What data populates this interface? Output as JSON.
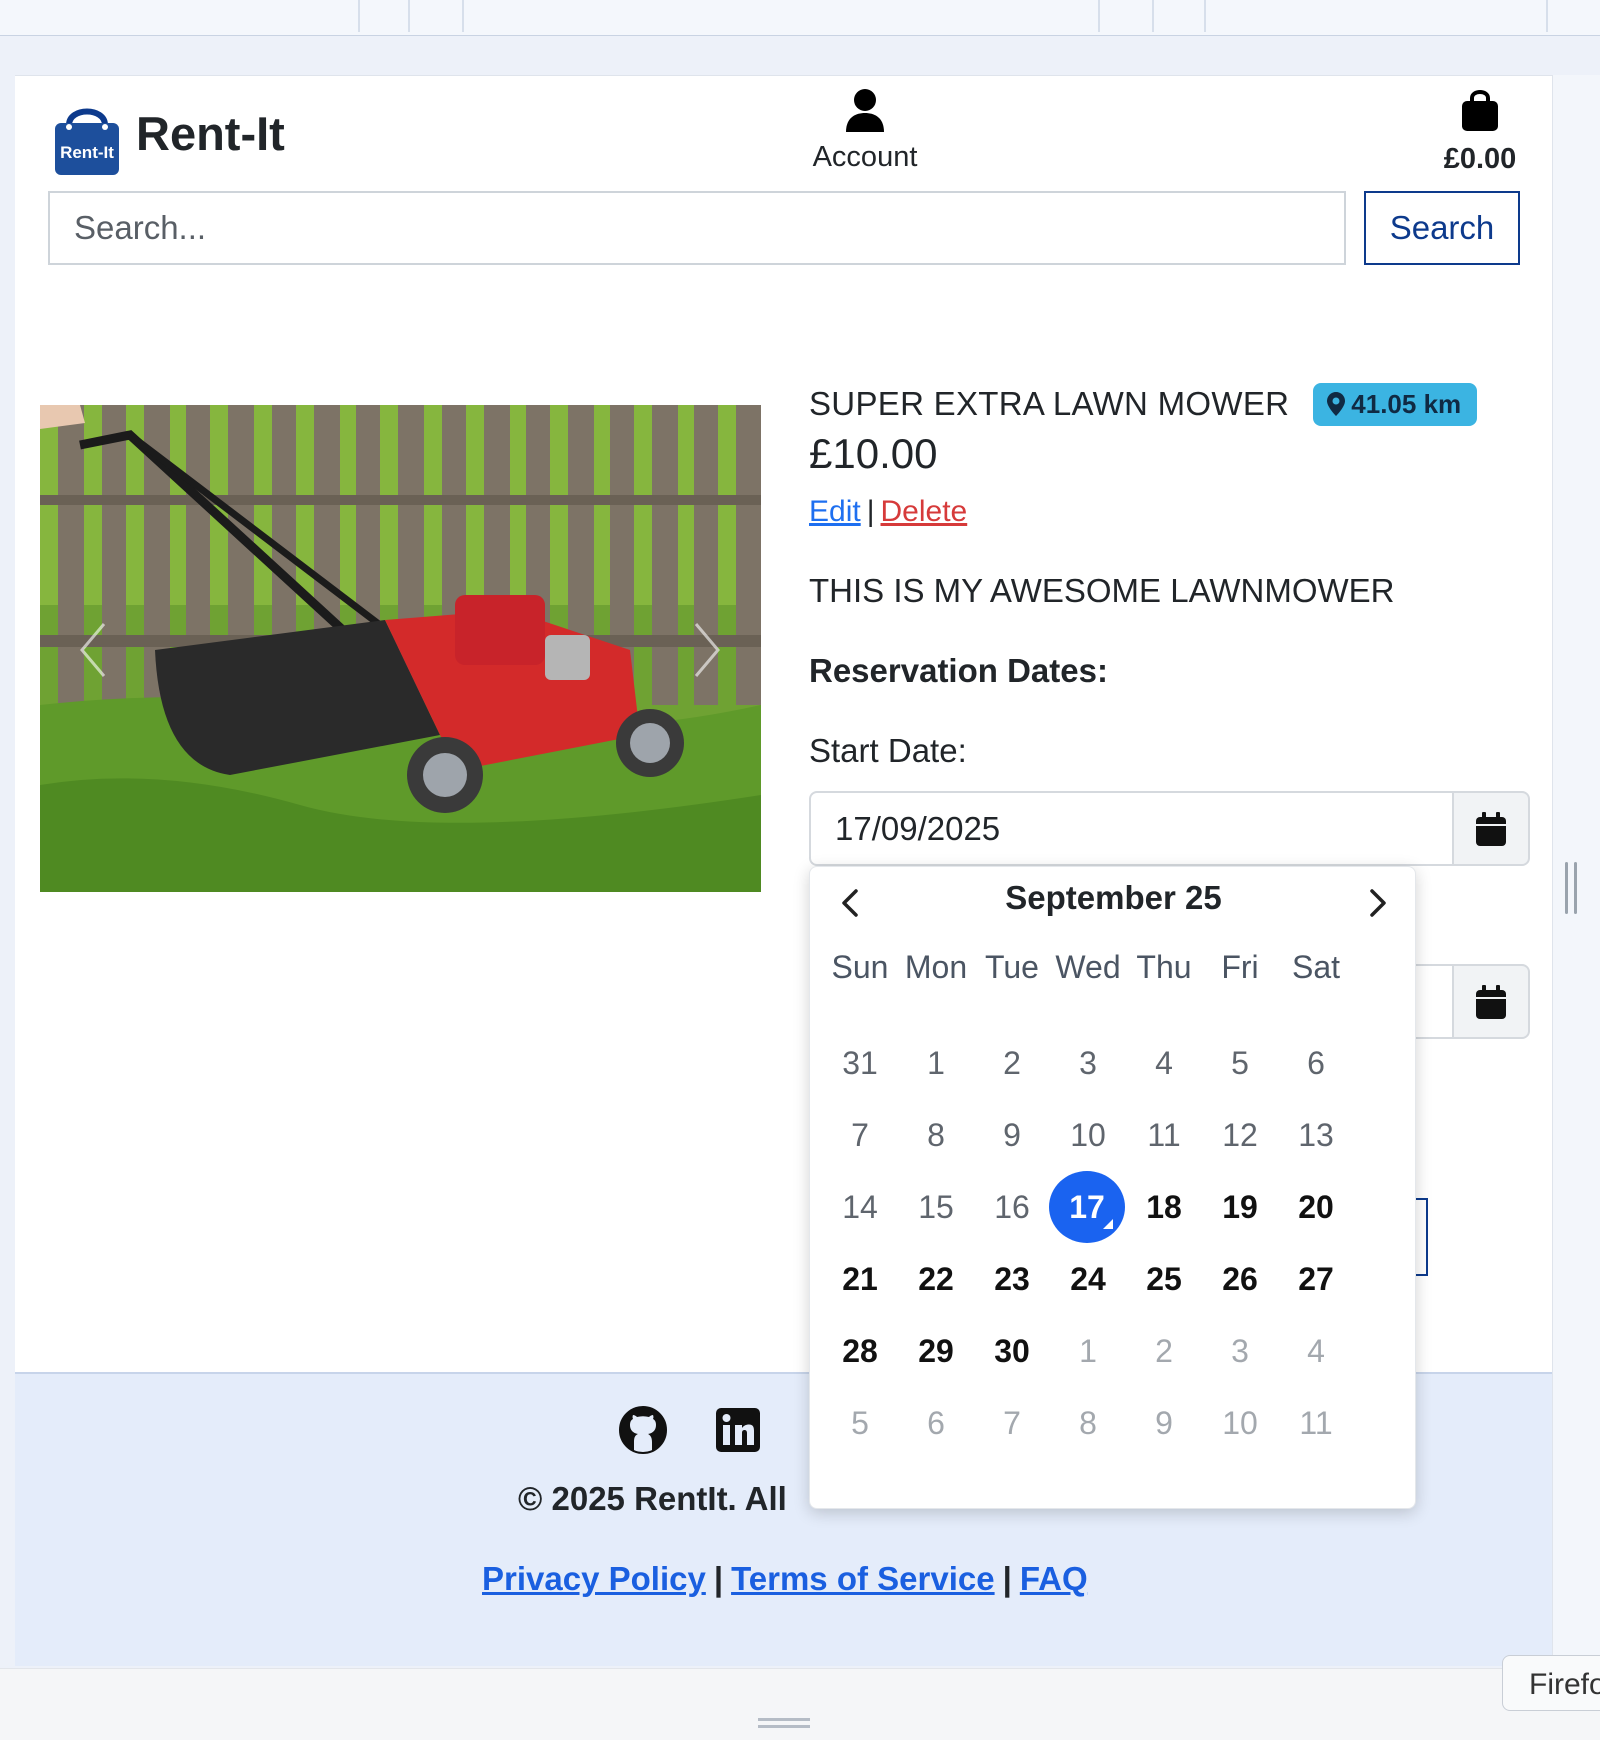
{
  "header": {
    "logo_text": "Rent-It",
    "brand_name": "Rent-It",
    "account_label": "Account",
    "cart_total": "£0.00",
    "search_placeholder": "Search...",
    "search_button": "Search"
  },
  "product": {
    "title": "SUPER EXTRA LAWN MOWER",
    "distance": "41.05 km",
    "price": "£10.00",
    "edit_label": "Edit",
    "separator": "|",
    "delete_label": "Delete",
    "description": "THIS IS MY AWESOME LAWNMOWER",
    "reservation_heading": "Reservation Dates:",
    "start_label": "Start Date:",
    "start_value": "17/09/2025",
    "end_value": ""
  },
  "datepicker": {
    "month_title": "September 25",
    "weekdays": [
      "Sun",
      "Mon",
      "Tue",
      "Wed",
      "Thu",
      "Fri",
      "Sat"
    ],
    "selected_day": "17",
    "weeks": [
      [
        {
          "d": "31",
          "s": "disabled"
        },
        {
          "d": "1",
          "s": "disabled"
        },
        {
          "d": "2",
          "s": "disabled"
        },
        {
          "d": "3",
          "s": "disabled"
        },
        {
          "d": "4",
          "s": "disabled"
        },
        {
          "d": "5",
          "s": "disabled"
        },
        {
          "d": "6",
          "s": "disabled"
        }
      ],
      [
        {
          "d": "7",
          "s": "disabled"
        },
        {
          "d": "8",
          "s": "disabled"
        },
        {
          "d": "9",
          "s": "disabled"
        },
        {
          "d": "10",
          "s": "disabled"
        },
        {
          "d": "11",
          "s": "disabled"
        },
        {
          "d": "12",
          "s": "disabled"
        },
        {
          "d": "13",
          "s": "disabled"
        }
      ],
      [
        {
          "d": "14",
          "s": "disabled"
        },
        {
          "d": "15",
          "s": "disabled"
        },
        {
          "d": "16",
          "s": "disabled"
        },
        {
          "d": "17",
          "s": "selected"
        },
        {
          "d": "18",
          "s": "enabled"
        },
        {
          "d": "19",
          "s": "enabled"
        },
        {
          "d": "20",
          "s": "enabled"
        }
      ],
      [
        {
          "d": "21",
          "s": "enabled"
        },
        {
          "d": "22",
          "s": "enabled"
        },
        {
          "d": "23",
          "s": "enabled"
        },
        {
          "d": "24",
          "s": "enabled"
        },
        {
          "d": "25",
          "s": "enabled"
        },
        {
          "d": "26",
          "s": "enabled"
        },
        {
          "d": "27",
          "s": "enabled"
        }
      ],
      [
        {
          "d": "28",
          "s": "enabled"
        },
        {
          "d": "29",
          "s": "enabled"
        },
        {
          "d": "30",
          "s": "enabled"
        },
        {
          "d": "1",
          "s": "other"
        },
        {
          "d": "2",
          "s": "other"
        },
        {
          "d": "3",
          "s": "other"
        },
        {
          "d": "4",
          "s": "other"
        }
      ],
      [
        {
          "d": "5",
          "s": "other"
        },
        {
          "d": "6",
          "s": "other"
        },
        {
          "d": "7",
          "s": "other"
        },
        {
          "d": "8",
          "s": "other"
        },
        {
          "d": "9",
          "s": "other"
        },
        {
          "d": "10",
          "s": "other"
        },
        {
          "d": "11",
          "s": "other"
        }
      ]
    ]
  },
  "footer": {
    "copyright_visible": "© 2025 RentIt. All",
    "links": {
      "privacy": "Privacy Policy",
      "terms": "Terms of Service",
      "faq": "FAQ",
      "separator": "|"
    }
  },
  "browser": {
    "tooltip_text": "Firefo"
  },
  "colors": {
    "brand_navy": "#0d3a8c",
    "badge": "#3bb4e2",
    "link_blue": "#1e6ff0",
    "delete_red": "#d63a3a",
    "selected_day": "#1a63f0",
    "footer_bg": "#e4ecfa"
  },
  "icons": {
    "account": "user-icon",
    "cart": "shopping-bag-icon",
    "badge": "map-pin-icon",
    "calendar": "calendar-icon",
    "footer": [
      "github-icon",
      "linkedin-icon"
    ]
  }
}
